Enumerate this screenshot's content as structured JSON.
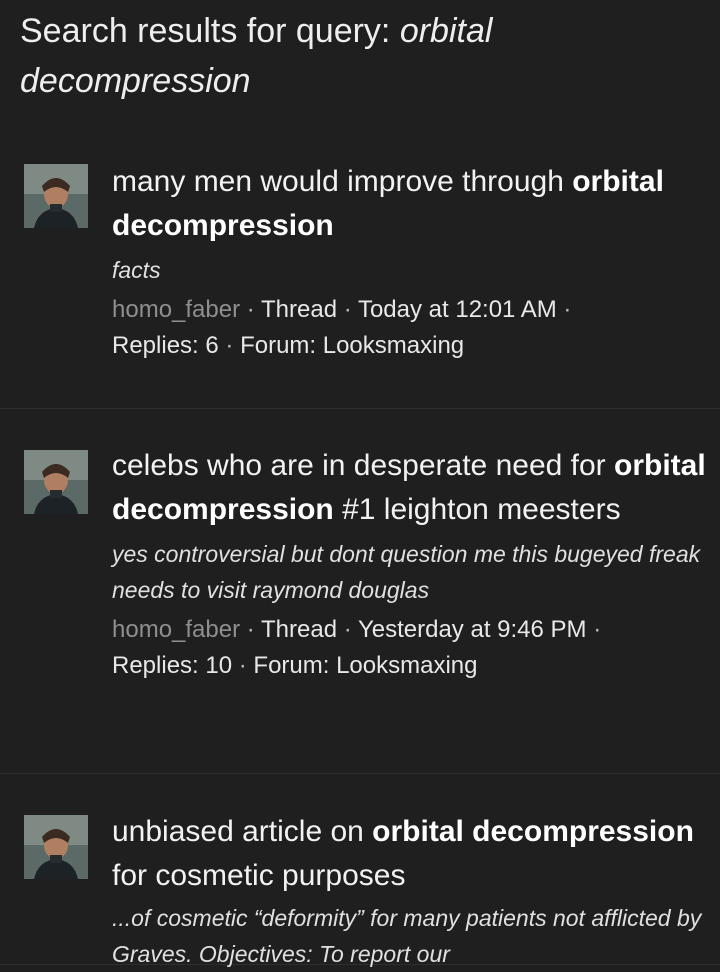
{
  "header": {
    "prefix": "Search results for query: ",
    "query": "orbital decompression"
  },
  "results": [
    {
      "title_parts": [
        {
          "text": "many men would improve through ",
          "bold": false
        },
        {
          "text": "orbital decompression",
          "bold": true
        }
      ],
      "snippet": "facts",
      "author": "homo_faber",
      "type": "Thread",
      "date": "Today at 12:01 AM",
      "replies": "Replies: 6",
      "forum": "Forum: Looksmaxing"
    },
    {
      "title_parts": [
        {
          "text": "celebs who are in desperate need for ",
          "bold": false
        },
        {
          "text": "orbital decompression",
          "bold": true
        },
        {
          "text": " #1 leighton meesters",
          "bold": false
        }
      ],
      "snippet": "yes controversial but dont question me this bugeyed freak needs to visit raymond douglas",
      "author": "homo_faber",
      "type": "Thread",
      "date": "Yesterday at 9:46 PM",
      "replies": "Replies: 10",
      "forum": "Forum: Looksmaxing"
    },
    {
      "title_parts": [
        {
          "text": "unbiased article on ",
          "bold": false
        },
        {
          "text": "orbital decompression",
          "bold": true
        },
        {
          "text": " for cosmetic purposes",
          "bold": false
        }
      ],
      "snippet": "...of cosmetic “deformity” for many patients not afflicted by Graves. Objectives: To report our",
      "author": "",
      "type": "",
      "date": "",
      "replies": "",
      "forum": ""
    }
  ],
  "colors": {
    "background": "#1f1f1f",
    "text": "#e8e8e8",
    "author": "#8f8f8f",
    "divider": "#2e2e2e"
  },
  "icons": {
    "avatar": "user-avatar-photo"
  }
}
